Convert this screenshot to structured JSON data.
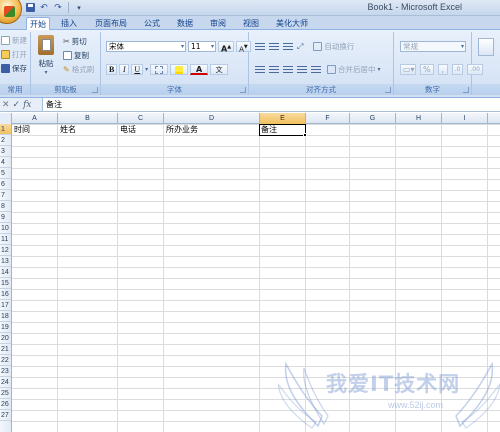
{
  "window": {
    "title": "Book1 - Microsoft Excel"
  },
  "qat": {
    "icons": [
      "save-icon",
      "undo-icon",
      "redo-icon",
      "customize-icon"
    ]
  },
  "tabs": [
    {
      "label": "开始",
      "active": true
    },
    {
      "label": "插入"
    },
    {
      "label": "页面布局"
    },
    {
      "label": "公式"
    },
    {
      "label": "数据"
    },
    {
      "label": "审阅"
    },
    {
      "label": "视图"
    },
    {
      "label": "美化大师"
    }
  ],
  "ribbon": {
    "common": {
      "new": "新建",
      "open": "打开",
      "save": "保存",
      "title": "常用"
    },
    "clipboard": {
      "paste": "粘贴",
      "cut": "剪切",
      "copy": "复制",
      "format_painter": "格式刷",
      "title": "剪贴板"
    },
    "font": {
      "name": "宋体",
      "size": "11",
      "grow": "A",
      "shrink": "A",
      "bold": "B",
      "italic": "I",
      "underline": "U",
      "color_a": "A",
      "phonetic": "文",
      "title": "字体"
    },
    "alignment": {
      "wrap": "自动换行",
      "merge": "合并后居中",
      "title": "对齐方式"
    },
    "number": {
      "format": "常规",
      "percent": "%",
      "comma": ",",
      "title": "数字"
    }
  },
  "formula_bar": {
    "cancel": "✕",
    "enter": "✓",
    "fx": "fx",
    "content": "备注"
  },
  "grid": {
    "columns": [
      "A",
      "B",
      "C",
      "D",
      "E",
      "F",
      "G",
      "H",
      "I"
    ],
    "selected_column": "E",
    "rows": [
      "1",
      "2",
      "3",
      "4",
      "5",
      "6",
      "7",
      "8",
      "9",
      "10",
      "11",
      "12",
      "13",
      "14",
      "15",
      "16",
      "17",
      "18",
      "19",
      "20",
      "21",
      "22",
      "23",
      "24",
      "25",
      "26",
      "27"
    ],
    "row1": {
      "A": "时间",
      "B": "姓名",
      "C": "电话",
      "D": "所办业务",
      "E": "备注"
    },
    "active_cell": "E1"
  },
  "watermark": {
    "text": "我爱IT技术网",
    "url": "www.52ij.com"
  }
}
